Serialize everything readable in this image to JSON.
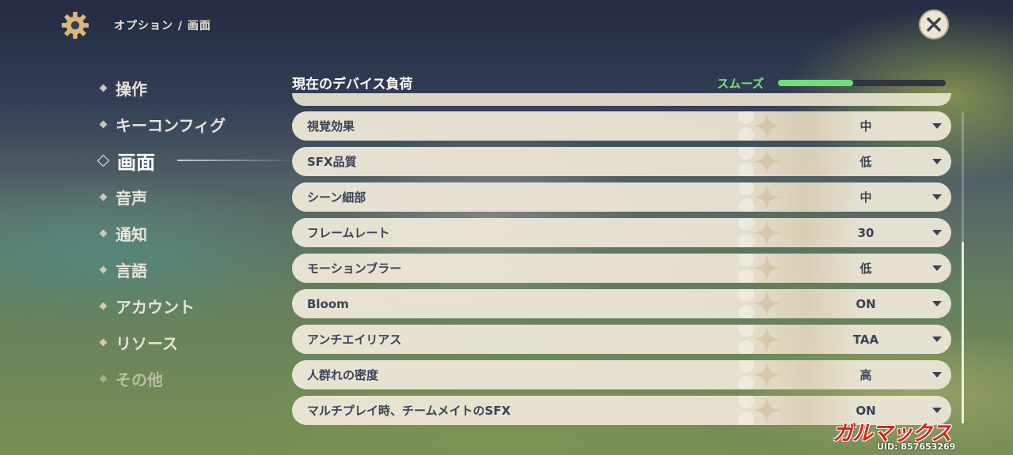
{
  "header": {
    "breadcrumb": "オプション / 画面",
    "icons": {
      "settings": "gear-icon",
      "close": "close-icon"
    }
  },
  "sidebar": {
    "items": [
      {
        "label": "操作",
        "state": "normal"
      },
      {
        "label": "キーコンフィグ",
        "state": "normal"
      },
      {
        "label": "画面",
        "state": "active"
      },
      {
        "label": "音声",
        "state": "normal"
      },
      {
        "label": "通知",
        "state": "normal"
      },
      {
        "label": "言語",
        "state": "normal"
      },
      {
        "label": "アカウント",
        "state": "normal"
      },
      {
        "label": "リソース",
        "state": "normal"
      },
      {
        "label": "その他",
        "state": "dim"
      }
    ]
  },
  "device_load": {
    "title": "現在のデバイス負荷",
    "status": "スムーズ",
    "level_fraction": 0.45,
    "status_color": "#6ee07a"
  },
  "settings": [
    {
      "label": "視覚効果",
      "value": "中"
    },
    {
      "label": "SFX品質",
      "value": "低"
    },
    {
      "label": "シーン細部",
      "value": "中"
    },
    {
      "label": "フレームレート",
      "value": "30"
    },
    {
      "label": "モーションブラー",
      "value": "低"
    },
    {
      "label": "Bloom",
      "value": "ON"
    },
    {
      "label": "アンチエイリアス",
      "value": "TAA"
    },
    {
      "label": "人群れの密度",
      "value": "高"
    },
    {
      "label": "マルチプレイ時、チームメイトのSFX",
      "value": "ON"
    }
  ],
  "watermark": {
    "brand": "ガルマックス",
    "uid": "UID: 857653269",
    "color": "#e11d1d"
  }
}
